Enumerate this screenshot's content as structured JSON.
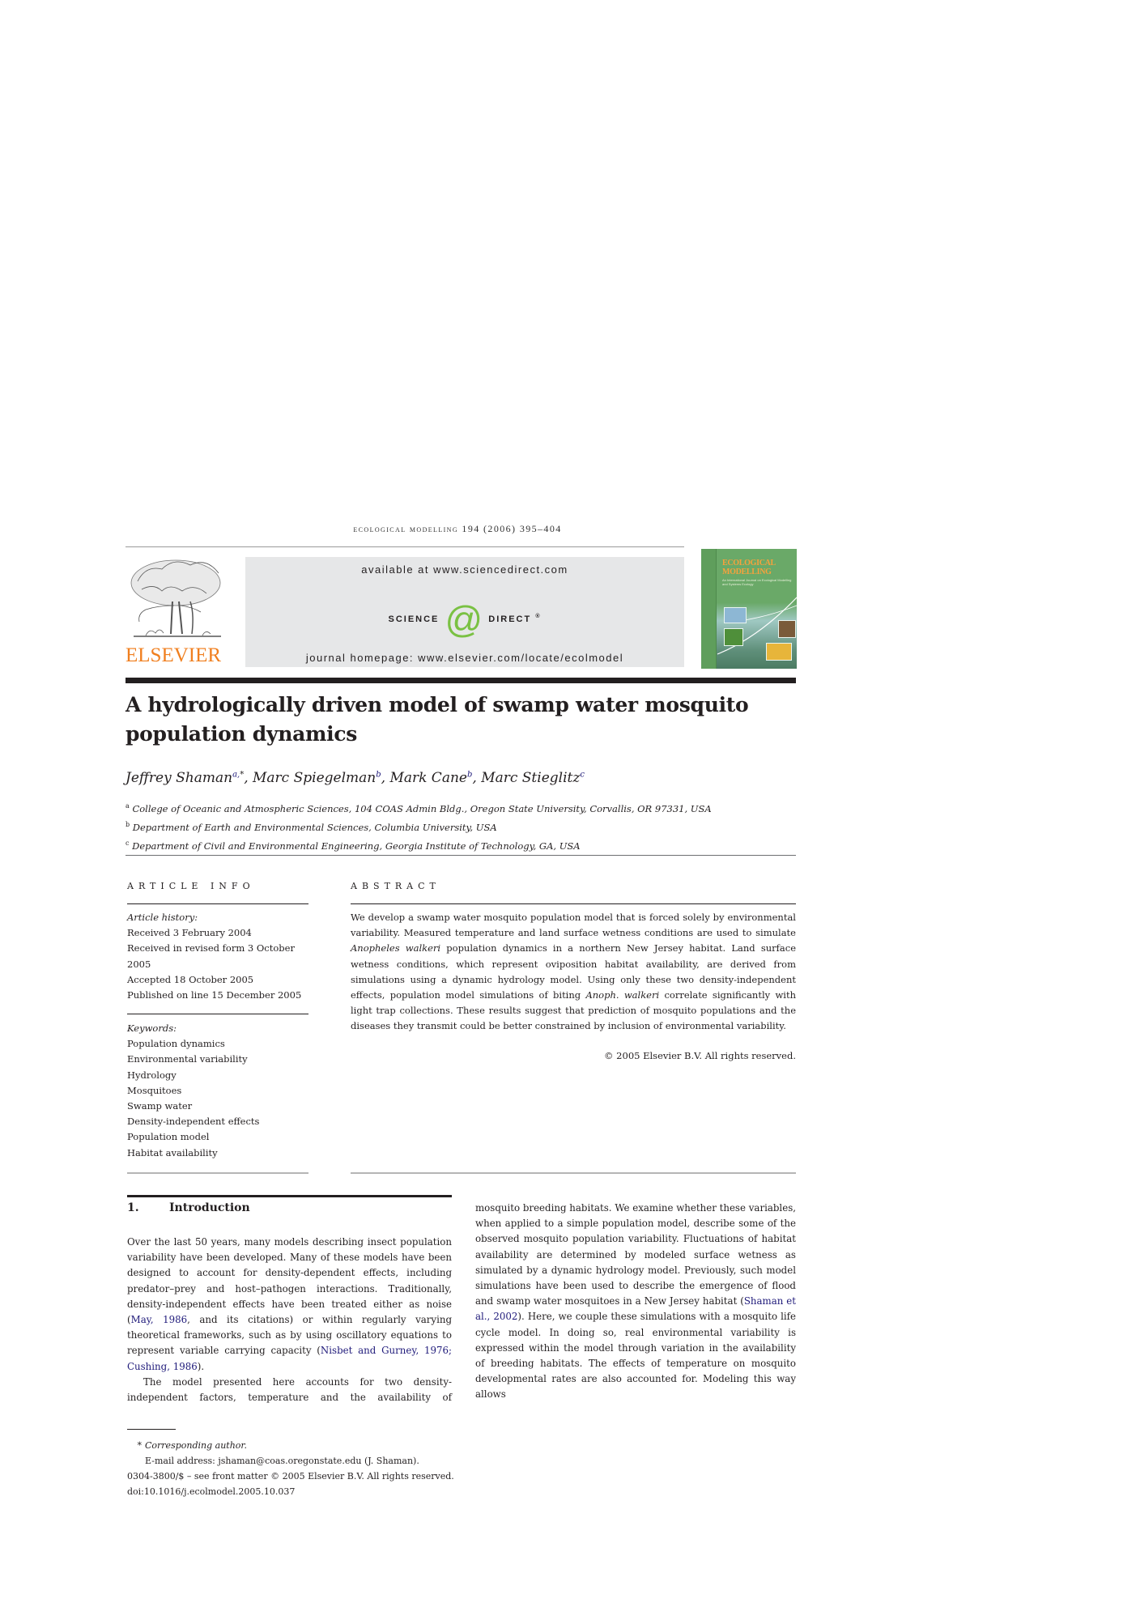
{
  "header": {
    "journal_line": "ecological modelling 194 (2006) 395–404",
    "publisher_wordmark": "ELSEVIER",
    "available_text": "available at www.sciencedirect.com",
    "sciencedirect_left": "SCIENCE",
    "sciencedirect_at": "@",
    "sciencedirect_right": "DIRECT",
    "sciencedirect_reg": "®",
    "homepage_text": "journal homepage: www.elsevier.com/locate/ecolmodel",
    "cover": {
      "title_line1": "ECOLOGICAL",
      "title_line2": "MODELLING",
      "subtitle": "An International Journal on Ecological Modelling and Systems Ecology"
    },
    "colors": {
      "elsevier_orange": "#f07f1f",
      "sciencedirect_green": "#7ac143",
      "banner_gray": "#e6e7e8",
      "cover_green": "#6aa968",
      "citation_blue": "#1f1a7a"
    }
  },
  "article": {
    "title": "A hydrologically driven model of swamp water mosquito population dynamics",
    "authors": [
      {
        "name": "Jeffrey Shaman",
        "sup": "a,",
        "star": "*",
        "sep": ", "
      },
      {
        "name": "Marc Spiegelman",
        "sup": "b",
        "star": "",
        "sep": ", "
      },
      {
        "name": "Mark Cane",
        "sup": "b",
        "star": "",
        "sep": ", "
      },
      {
        "name": "Marc Stieglitz",
        "sup": "c",
        "star": "",
        "sep": ""
      }
    ],
    "affiliations": [
      {
        "key": "a",
        "text": "College of Oceanic and Atmospheric Sciences, 104 COAS Admin Bldg., Oregon State University, Corvallis, OR 97331, USA"
      },
      {
        "key": "b",
        "text": "Department of Earth and Environmental Sciences, Columbia University, USA"
      },
      {
        "key": "c",
        "text": "Department of Civil and Environmental Engineering, Georgia Institute of Technology, GA, USA"
      }
    ]
  },
  "article_info": {
    "heading": "ARTICLE INFO",
    "history_label": "Article history:",
    "history": [
      "Received 3 February 2004",
      "Received in revised form 3 October 2005",
      "Accepted 18 October 2005",
      "Published on line 15 December 2005"
    ],
    "keywords_label": "Keywords:",
    "keywords": [
      "Population dynamics",
      "Environmental variability",
      "Hydrology",
      "Mosquitoes",
      "Swamp water",
      "Density-independent effects",
      "Population model",
      "Habitat availability"
    ]
  },
  "abstract": {
    "heading": "ABSTRACT",
    "part1": "We develop a swamp water mosquito population model that is forced solely by environmental variability. Measured temperature and land surface wetness conditions are used to simulate ",
    "italic1": "Anopheles walkeri",
    "part2": " population dynamics in a northern New Jersey habitat. Land surface wetness conditions, which represent oviposition habitat availability, are derived from simulations using a dynamic hydrology model. Using only these two density-independent effects, population model simulations of biting ",
    "italic2": "Anoph. walkeri",
    "part3": " correlate significantly with light trap collections. These results suggest that prediction of mosquito populations and the diseases they transmit could be better constrained by inclusion of environmental variability.",
    "copyright": "© 2005 Elsevier B.V. All rights reserved."
  },
  "introduction": {
    "number": "1.",
    "heading": "Introduction",
    "p1_a": "Over the last 50 years, many models describing insect population variability have been developed. Many of these models have been designed to account for density-dependent effects, including predator–prey and host–pathogen interactions. Traditionally, density-independent effects have been treated either as noise (",
    "p1_cite1": "May, 1986",
    "p1_b": ", and its citations) or within regularly varying theoretical frameworks, such as by using oscillatory equations to represent variable carrying capacity (",
    "p1_cite2": "Nisbet and Gurney, 1976; Cushing, 1986",
    "p1_c": ").",
    "p2_a": "The model presented here accounts for two density-independent factors, temperature and the availability of mosquito breeding habitats. We examine whether these variables, when applied to a simple population model, describe some of the observed mosquito population variability. Fluctuations of habitat availability are determined by modeled surface wetness as simulated by a dynamic hydrology model. Previously, such model simulations have been used to describe the emergence of flood and swamp water mosquitoes in a New Jersey habitat (",
    "p2_cite": "Shaman et al., 2002",
    "p2_b": "). Here, we couple these simulations with a mosquito life cycle model. In doing so, real environmental variability is expressed within the model through variation in the availability of breeding habitats. The effects of temperature on mosquito developmental rates are also accounted for. Modeling this way allows"
  },
  "footnotes": {
    "star": "*",
    "corresponding": "Corresponding author.",
    "email": "E-mail address: jshaman@coas.oregonstate.edu (J. Shaman).",
    "front_matter": "0304-3800/$ – see front matter © 2005 Elsevier B.V. All rights reserved.",
    "doi": "doi:10.1016/j.ecolmodel.2005.10.037"
  }
}
